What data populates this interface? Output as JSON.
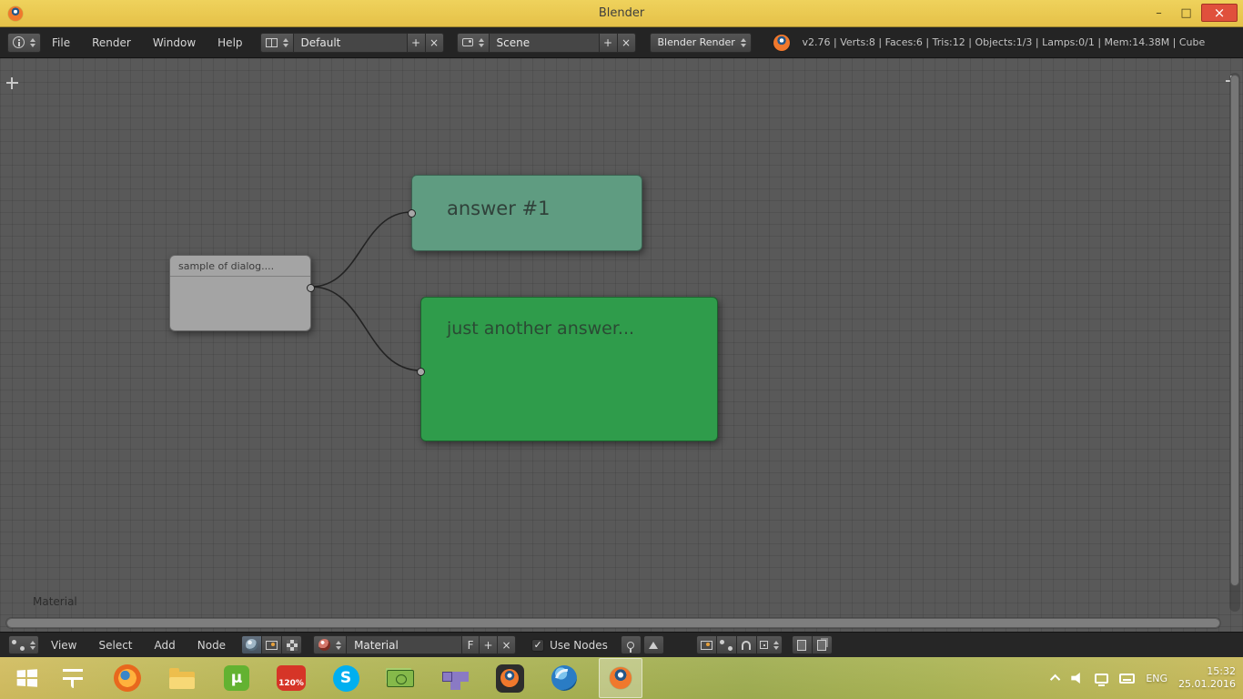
{
  "window": {
    "title": "Blender",
    "minimize_glyph": "–",
    "maximize_glyph": "□",
    "close_glyph": "×"
  },
  "glyphs": {
    "plus": "+",
    "x": "×",
    "check": "✓"
  },
  "info_header": {
    "menus": [
      "File",
      "Render",
      "Window",
      "Help"
    ],
    "layout_value": "Default",
    "scene_value": "Scene",
    "engine_value": "Blender Render",
    "stats": "v2.76 | Verts:8 | Faces:6 | Tris:12 | Objects:1/3 | Lamps:0/1 | Mem:14.38M | Cube"
  },
  "node_editor": {
    "region_label": "Material",
    "link_color": "#232323",
    "nodes": {
      "dialog": {
        "label": "sample of dialog....",
        "color": "#a4a4a4",
        "text_color": "#3b3b3b"
      },
      "answer1": {
        "label": "answer #1",
        "color": "#5f9c81",
        "text_color": "#30413a"
      },
      "answer2": {
        "label": "just another answer...",
        "color": "#2f9c4b",
        "text_color": "#2b4a34"
      }
    }
  },
  "node_header": {
    "menus": [
      "View",
      "Select",
      "Add",
      "Node"
    ],
    "material_name": "Material",
    "fake_user_label": "F",
    "use_nodes_label": "Use Nodes"
  },
  "taskbar": {
    "speed_badge": "120%",
    "skype_letter": "S",
    "utorrent_letter": "µ",
    "tray": {
      "language": "ENG",
      "time": "15:32",
      "date": "25.01.2016"
    }
  }
}
